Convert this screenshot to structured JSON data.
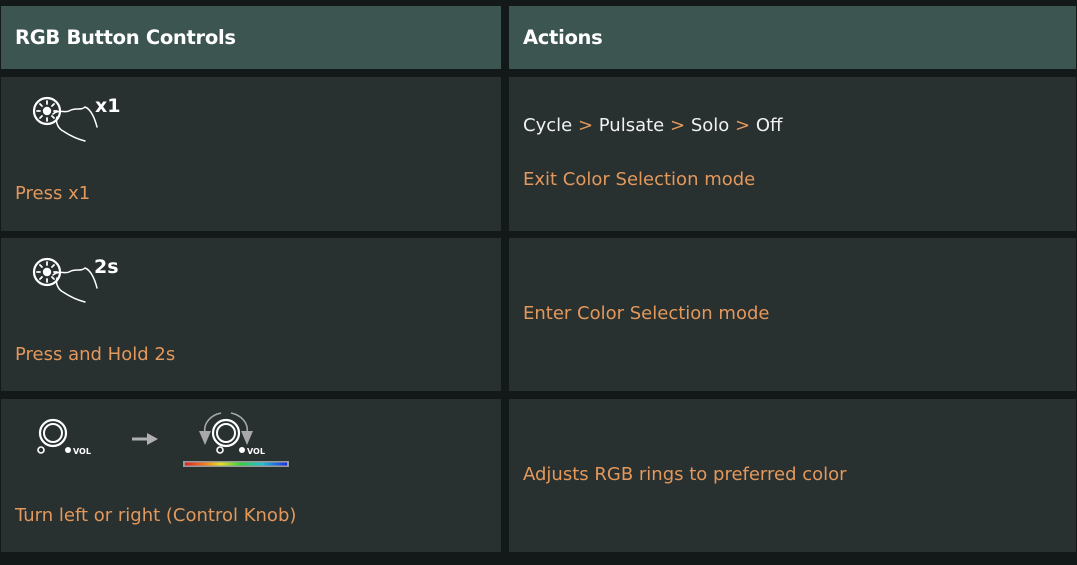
{
  "header": {
    "col1": "RGB Button Controls",
    "col2": "Actions"
  },
  "rows": [
    {
      "icon": "press-button-icon",
      "icon_badge": "x1",
      "label": "Press x1",
      "actions": {
        "sequence": [
          "Cycle",
          "Pulsate",
          "Solo",
          "Off"
        ],
        "separator": ">",
        "secondary": "Exit Color Selection mode"
      }
    },
    {
      "icon": "press-hold-button-icon",
      "icon_badge": "2s",
      "label": "Press and Hold 2s",
      "actions": {
        "primary": "Enter Color Selection mode"
      }
    },
    {
      "icon": "control-knob-turn-icon",
      "knob_label": "VOL",
      "label": "Turn left or right (Control Knob)",
      "actions": {
        "primary": "Adjusts RGB rings to preferred color"
      }
    }
  ],
  "colors": {
    "background": "#131918",
    "header_bg": "#3c5551",
    "cell_bg": "#283030",
    "accent_orange": "#e3985c",
    "text_white": "#f1f1f1"
  }
}
